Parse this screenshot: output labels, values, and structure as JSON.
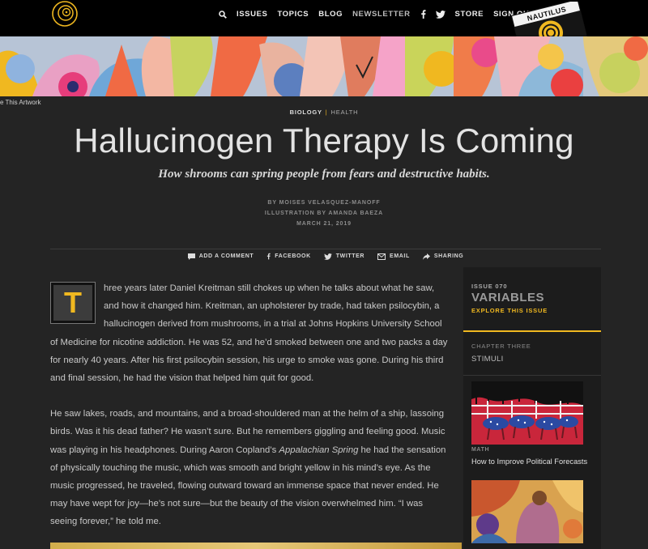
{
  "nav": {
    "items": [
      "ISSUES",
      "TOPICS",
      "BLOG",
      "NEWSLETTER",
      "STORE",
      "SIGN OUT"
    ],
    "magazine_label": "NAUTILUS"
  },
  "banner": {
    "alt_text": "e This Artwork"
  },
  "article": {
    "category_primary": "BIOLOGY",
    "category_secondary": "HEALTH",
    "title": "Hallucinogen Therapy Is Coming",
    "subtitle": "How shrooms can spring people from fears and destructive habits.",
    "author": "BY MOISES VELASQUEZ-MANOFF",
    "illustrator": "ILLUSTRATION BY AMANDA BAEZA",
    "date": "MARCH 21, 2019",
    "drop_cap": "T",
    "p1": "hree years later Daniel Kreitman still chokes up when he talks about what he saw, and how it changed him. Kreitman, an upholsterer by trade, had taken psilocybin, a hallucinogen derived from mushrooms, in a trial at Johns Hopkins University School of Medicine for nicotine addiction. He was 52, and he’d smoked between one and two packs a day for nearly 40 years. After his first psilocybin session, his urge to smoke was gone. During his third and final session, he had the vision that helped him quit for good.",
    "p2_a": "He saw lakes, roads, and mountains, and a broad-shouldered man at the helm of a ship, lassoing birds. Was it his dead father? He wasn’t sure. But he remembers giggling and feeling good. Music was playing in his headphones. During Aaron Copland’s ",
    "p2_em": "Appalachian Spring",
    "p2_b": " he had the sensation of physically touching the music, which was smooth and bright yellow in his mind’s eye. As the music progressed, he traveled, flowing outward toward an immense space that never ended. He may have wept for joy—he’s not sure—but the beauty of the vision overwhelmed him. “I was seeing forever,” he told me."
  },
  "share": {
    "comment": "ADD A COMMENT",
    "facebook": "FACEBOOK",
    "twitter": "TWITTER",
    "email": "EMAIL",
    "sharing": "SHARING"
  },
  "sidebar": {
    "issue_label": "ISSUE 070",
    "issue_theme": "VARIABLES",
    "explore_label": "EXPLORE THIS ISSUE",
    "chapter_label": "CHAPTER THREE",
    "chapter_name": "STIMULI",
    "related_kicker": "MATH",
    "related_headline": "How to Improve Political Forecasts"
  },
  "colors": {
    "accent": "#f0b820",
    "background": "#242424",
    "nav_background": "#000000"
  }
}
